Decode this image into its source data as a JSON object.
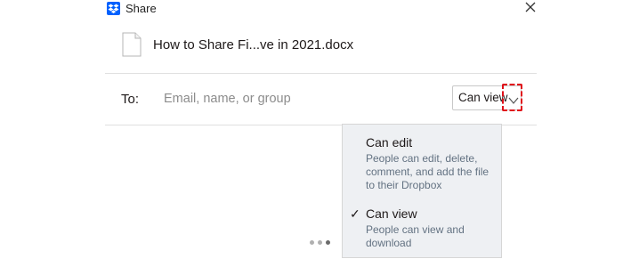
{
  "window": {
    "title": "Share",
    "logo_icon": "dropbox-logo-icon",
    "close_icon": "close-icon"
  },
  "file": {
    "icon": "document-icon",
    "name": "How to Share Fi...ve in 2021.docx"
  },
  "share_to": {
    "label": "To:",
    "placeholder": "Email, name, or group",
    "value": ""
  },
  "permission": {
    "selected": "Can view",
    "chevron_icon": "chevron-down-icon",
    "options": [
      {
        "title": "Can edit",
        "description": "People can edit, delete, comment, and add the file to their Dropbox",
        "selected": false
      },
      {
        "title": "Can view",
        "description": "People can view and download",
        "selected": true
      }
    ]
  },
  "colors": {
    "brand": "#0061fe",
    "highlight": "#e0101a",
    "dropdown_bg": "#eef0f3"
  }
}
